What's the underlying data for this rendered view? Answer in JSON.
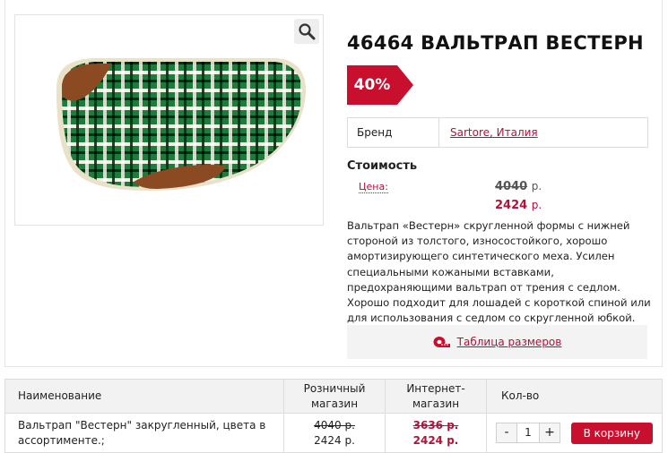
{
  "product": {
    "title": "46464 ВАЛЬТРАП ВЕСТЕРН",
    "discount": "40%",
    "brand_label": "Бренд",
    "brand_value": "Sartore, Италия",
    "price_heading": "Стоимость",
    "price_label": "Цена:",
    "old_price": "4040",
    "new_price": "2424",
    "currency": "р.",
    "description": "Вальтрап «Вестерн» скругленной формы с нижней стороной из толстого, износостойкого, хорошо амортизирующего синтетического меха. Усилен специальными кожаными вставками, предохраняющими вальтрап от трения с седлом. Хорошо подходит для лошадей с короткой спиной или для использования с седлом со скругленной юбкой.",
    "size_table_link": "Таблица размеров"
  },
  "offers": {
    "headers": {
      "name": "Наименование",
      "retail": "Розничный магазин",
      "internet": "Интернет-магазин",
      "qty": "Кол-во"
    },
    "rows": [
      {
        "name": "Вальтрап \"Вестерн\" закругленный, цвета в ассортименте.;",
        "retail_old": "4040 р.",
        "retail_new": "2424 р.",
        "internet_old": "3636 р.",
        "internet_new": "2424 р.",
        "qty": "1",
        "minus": "-",
        "plus": "+",
        "cart_label": "В корзину"
      }
    ]
  },
  "icons": {
    "zoom": "magnifier-icon",
    "size_table": "measuring-tape-icon"
  },
  "colors": {
    "accent": "#c8102e",
    "link": "#b0123a"
  }
}
